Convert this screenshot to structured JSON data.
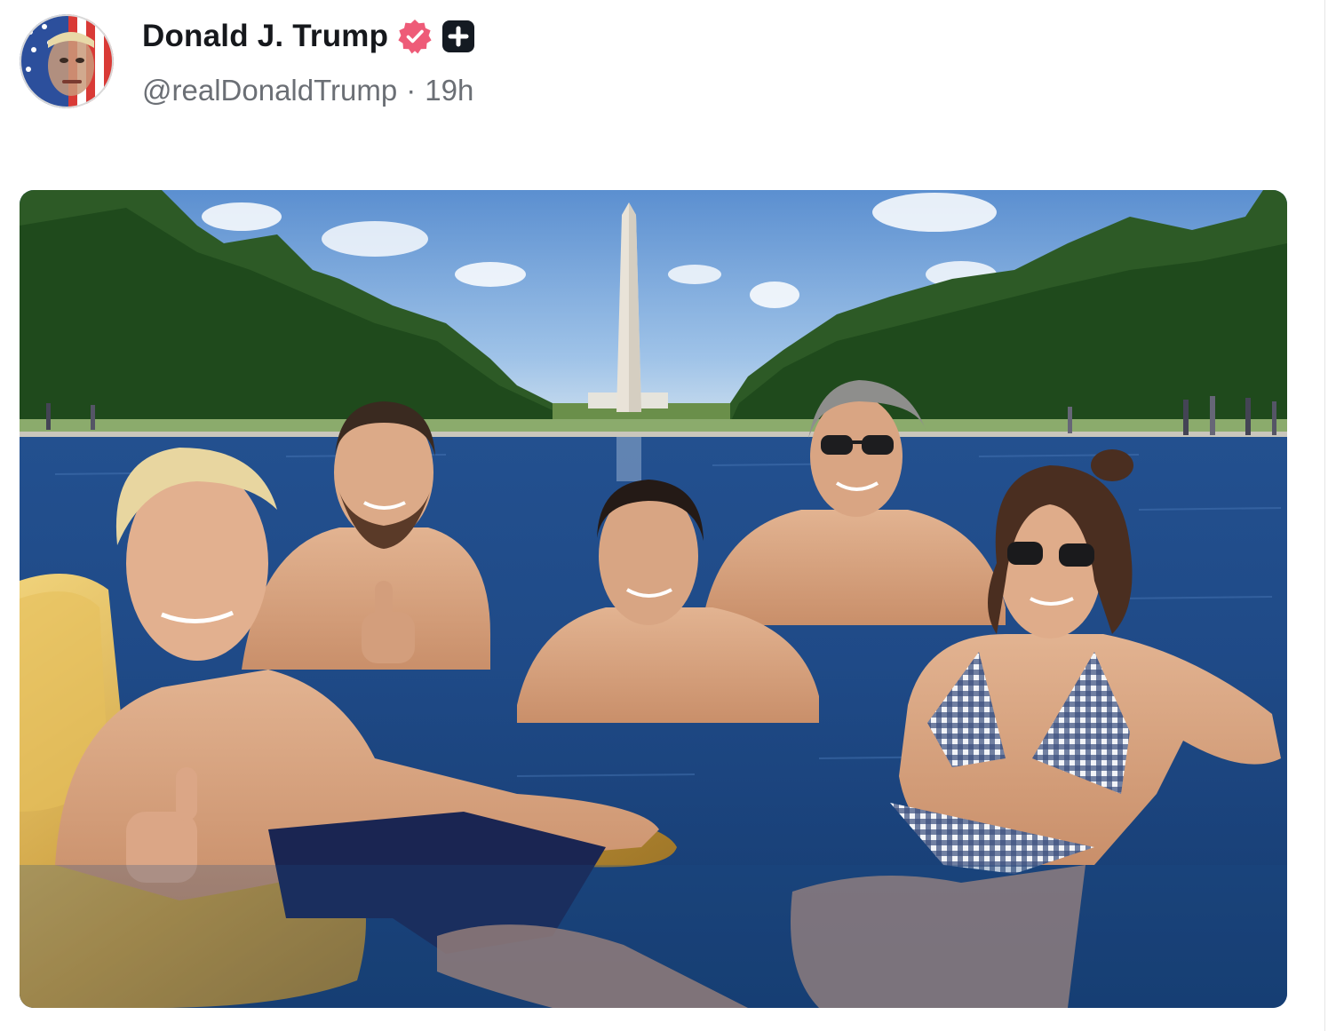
{
  "post": {
    "author": {
      "display_name": "Donald J. Trump",
      "handle": "@realDonaldTrump",
      "verified_icon": "verified-badge-icon",
      "premium_icon": "plus-badge-icon",
      "badge_color": "#ee5b78"
    },
    "separator": "·",
    "timestamp": "19h",
    "media": {
      "type": "photo",
      "icon": "photo-image"
    }
  }
}
